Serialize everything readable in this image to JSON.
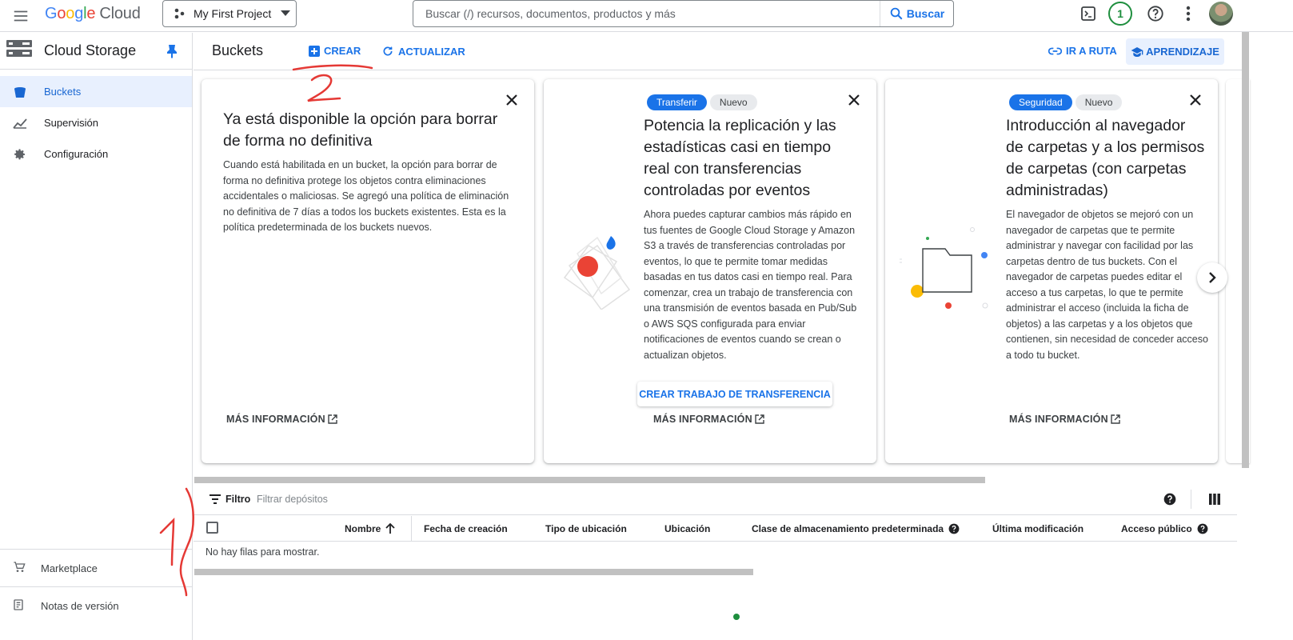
{
  "topbar": {
    "logo_letters": [
      "G",
      "o",
      "o",
      "g",
      "l",
      "e"
    ],
    "logo_suffix": "Cloud",
    "project_name": "My First Project",
    "search_placeholder": "Buscar (/) recursos, documentos, productos y más",
    "search_button": "Buscar",
    "notifications_count": "1",
    "icons": [
      "menu-icon",
      "project-icon",
      "dropdown-icon",
      "search-icon",
      "terminal-icon",
      "help-icon",
      "more-vert-icon",
      "avatar"
    ]
  },
  "sidebar": {
    "product_title": "Cloud Storage",
    "items": [
      {
        "label": "Buckets",
        "icon": "bucket-icon",
        "active": true
      },
      {
        "label": "Supervisión",
        "icon": "monitoring-icon",
        "active": false
      },
      {
        "label": "Configuración",
        "icon": "settings-icon",
        "active": false
      }
    ],
    "marketplace": "Marketplace",
    "release_notes": "Notas de versión"
  },
  "header": {
    "title": "Buckets",
    "create": "CREAR",
    "refresh": "ACTUALIZAR",
    "go_to_path": "IR A RUTA",
    "learning": "APRENDIZAJE"
  },
  "cards": [
    {
      "title": "Ya está disponible la opción para borrar de forma no definitiva",
      "body": "Cuando está habilitada en un bucket, la opción para borrar de forma no definitiva protege los objetos contra eliminaciones accidentales o maliciosas. Se agregó una política de eliminación no definitiva de 7 días a todos los buckets existentes. Esta es la política predeterminada de los buckets nuevos.",
      "link": "MÁS INFORMACIÓN"
    },
    {
      "chips": [
        "Transferir",
        "Nuevo"
      ],
      "title": "Potencia la replicación y las estadísticas casi en tiempo real con transferencias controladas por eventos",
      "body": "Ahora puedes capturar cambios más rápido en tus fuentes de Google Cloud Storage y Amazon S3 a través de transferencias controladas por eventos, lo que te permite tomar medidas basadas en tus datos casi en tiempo real. Para comenzar, crea un trabajo de transferencia con una transmisión de eventos basada en Pub/Sub o AWS SQS configurada para enviar notificaciones de eventos cuando se crean o actualizan objetos.",
      "button": "CREAR TRABAJO DE TRANSFERENCIA",
      "link": "MÁS INFORMACIÓN"
    },
    {
      "chips": [
        "Seguridad",
        "Nuevo"
      ],
      "title": "Introducción al navegador de carpetas y a los permisos de carpetas (con carpetas administradas)",
      "body": "El navegador de objetos se mejoró con un navegador de carpetas que te permite administrar y navegar con facilidad por las carpetas dentro de tus buckets. Con el navegador de carpetas puedes editar el acceso a tus carpetas, lo que te permite administrar el acceso (incluida la ficha de objetos) a las carpetas y a los objetos que contienen, sin necesidad de conceder acceso a todo tu bucket.",
      "link": "MÁS INFORMACIÓN"
    }
  ],
  "filter": {
    "label": "Filtro",
    "placeholder": "Filtrar depósitos"
  },
  "table": {
    "columns": [
      "Nombre",
      "Fecha de creación",
      "Tipo de ubicación",
      "Ubicación",
      "Clase de almacenamiento predeterminada",
      "Última modificación",
      "Acceso público"
    ],
    "empty_message": "No hay filas para mostrar."
  },
  "annotations": [
    "1",
    "2"
  ],
  "colors": {
    "accent": "#1a73e8",
    "annotation": "#e53935",
    "active_bg": "#e8f0fe"
  }
}
